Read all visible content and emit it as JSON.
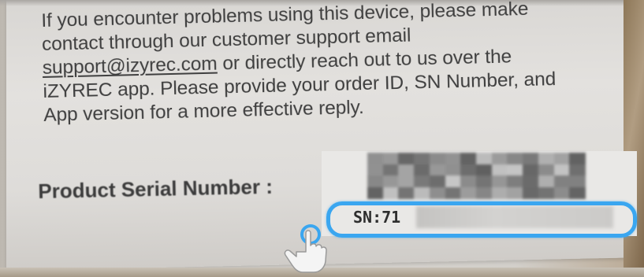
{
  "photo": {
    "top_fragment_text": "",
    "instruction_lines": [
      "If you encounter problems using this device, please make",
      "contact through our customer support email",
      "or directly reach out to us over the",
      "iZYREC app. Please provide your order ID, SN Number, and",
      "App version for a more effective reply."
    ],
    "support_email": "support@izyrec.com",
    "serial_label": "Product Serial Number :",
    "serial_prefix": "SN:71",
    "highlight_color": "#3aa6f0",
    "overlay_icon": "tap-hand-icon"
  }
}
